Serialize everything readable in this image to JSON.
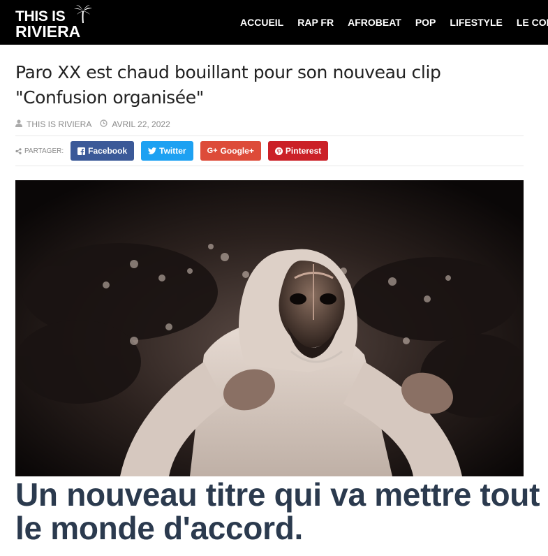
{
  "header": {
    "logo_line1": "THIS IS",
    "logo_line2": "RIVIERA",
    "nav": [
      "ACCUEIL",
      "RAP FR",
      "AFROBEAT",
      "POP",
      "LIFESTYLE",
      "LE COIN DE"
    ]
  },
  "article": {
    "title": "Paro XX est chaud bouillant pour son nouveau clip \"Confusion organisée\"",
    "author": "THIS IS RIVIERA",
    "date": "AVRIL 22, 2022",
    "share_label": "PARTAGER:",
    "share_buttons": [
      {
        "label": "Facebook",
        "icon": "facebook-icon",
        "color": "#3b5998"
      },
      {
        "label": "Twitter",
        "icon": "twitter-icon",
        "color": "#1da1f2"
      },
      {
        "label": "Google+",
        "icon": "google-plus-icon",
        "color": "#dd4b39"
      },
      {
        "label": "Pinterest",
        "icon": "pinterest-icon",
        "color": "#cb2027"
      }
    ],
    "subheading": "Un nouveau titre qui va mettre tout le monde d'accord."
  },
  "colors": {
    "header_bg": "#000000",
    "subheading": "#2b3a4e",
    "meta_text": "#8a8a8a"
  }
}
